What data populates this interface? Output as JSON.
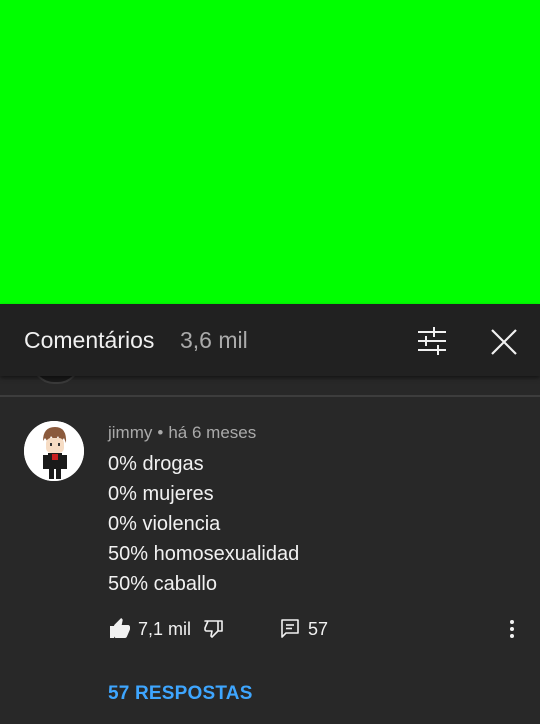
{
  "video": {
    "background_color": "#00ff00"
  },
  "header": {
    "title": "Comentários",
    "count": "3,6 mil",
    "filter_icon": "tune-icon",
    "close_icon": "close-icon"
  },
  "comment": {
    "author": "jimmy",
    "separator": "•",
    "time": "há 6 meses",
    "lines": [
      "0% drogas",
      "0% mujeres",
      "0% violencia",
      "50% homosexualidad",
      "50% caballo"
    ],
    "likes": "7,1 mil",
    "replies_count": "57",
    "replies_link": "57 RESPOSTAS",
    "link_color": "#3ea6ff"
  }
}
